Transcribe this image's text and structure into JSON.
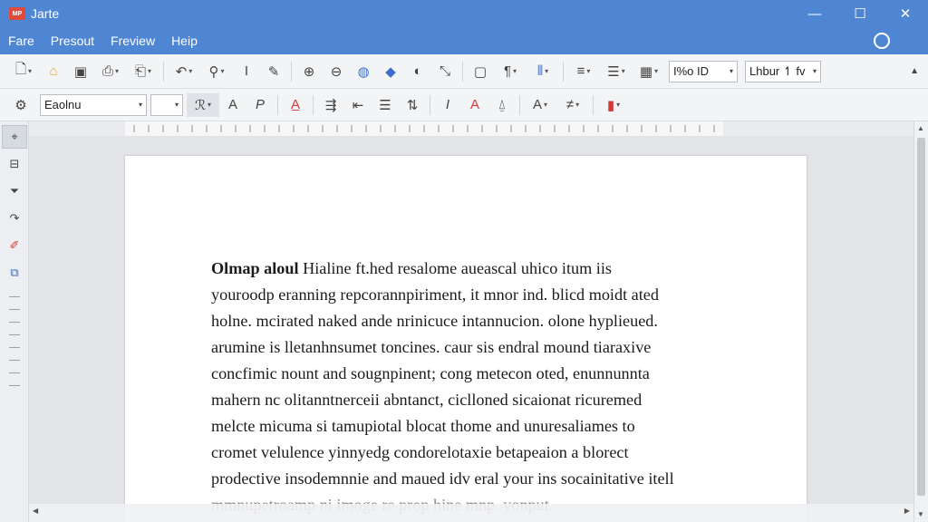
{
  "window": {
    "app_logo_text": "MP",
    "title": "Jarte",
    "controls": [
      "—",
      "☐",
      "✕"
    ]
  },
  "menu": {
    "items": [
      "Fare",
      "Presout",
      "Freview",
      "Heip"
    ]
  },
  "toolbar1": {
    "zoom_value": "I%o   ID",
    "style_value": "Lhbur   ↿  fv"
  },
  "toolbar2": {
    "font_name": "Eaolnu",
    "font_size": ""
  },
  "document": {
    "first_bold": "Olmap aloul",
    "lines": [
      " Hialine ft.hed resalome aueascal uhico itum iis",
      "youroodp eranning repcorannpiriment, it mnor ind. blicd moidt ated",
      "holne. mcirated naked ande nrinicuce intannucion. olone hyplieued.",
      "arumine is lletanhnsumet toncines. caur sis endral mound tiaraxive",
      "concfimic nount and sougnpinent; cong metecon oted, enunnunnta",
      "mahern nc olitanntnerceii abntanct, ciclloned sicaionat ricuremed",
      "melcte micuma si tamupiotal blocat thome and unuresaliames to",
      "cromet velulence yinnyedg condorelotaxie betapeaion a blorect",
      "prodective insodemnnie and maued idv eral your ins socainitative itell",
      "mmnupetroamp ni imoge re prop hine mnp. yonput."
    ]
  },
  "colors": {
    "titlebar": "#4f86d4",
    "accent_red": "#d43a3a",
    "accent_blue": "#3b6fc8"
  }
}
